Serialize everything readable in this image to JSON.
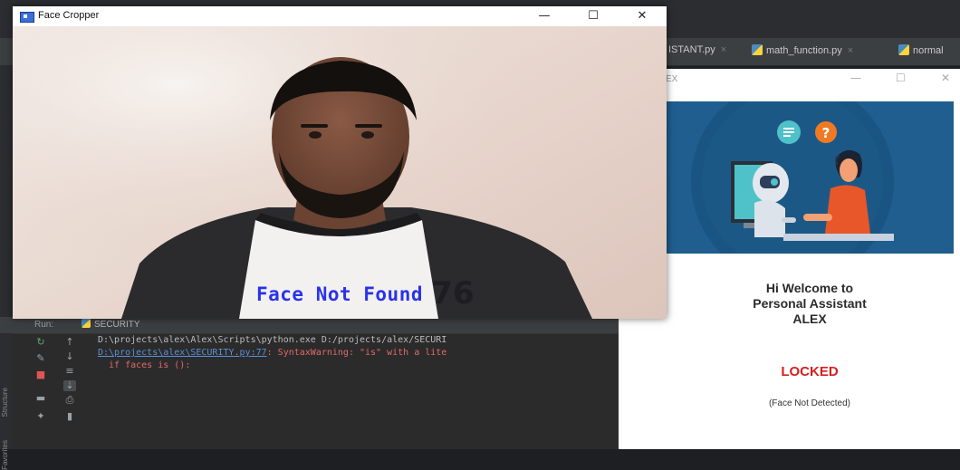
{
  "ide": {
    "tabs": [
      {
        "label": "ISTANT.py"
      },
      {
        "label": "math_function.py"
      },
      {
        "label": "normal"
      }
    ],
    "run_panel": {
      "label": "Run:",
      "tab": "SECURITY",
      "side_labels": [
        "Structure",
        "Favorites"
      ],
      "console_lines": [
        "D:\\projects\\alex\\Alex\\Scripts\\python.exe D:/projects/alex/SECURI",
        "D:\\projects\\alex\\SECURITY.py:77",
        ": SyntaxWarning: \"is\" with a lite",
        "  if faces is ():"
      ]
    }
  },
  "face_cropper": {
    "title": "Face Cropper",
    "status_text": "Face Not Found",
    "shirt_number": "76",
    "status_color": "#2a33e8"
  },
  "alex": {
    "title": "EX",
    "welcome_lines": [
      "Hi Welcome to",
      "Personal Assistant",
      "ALEX"
    ],
    "lock_status": "LOCKED",
    "detail": "(Face Not Detected)",
    "lock_color": "#d61f1f",
    "banner_color": "#1f5e8f"
  }
}
